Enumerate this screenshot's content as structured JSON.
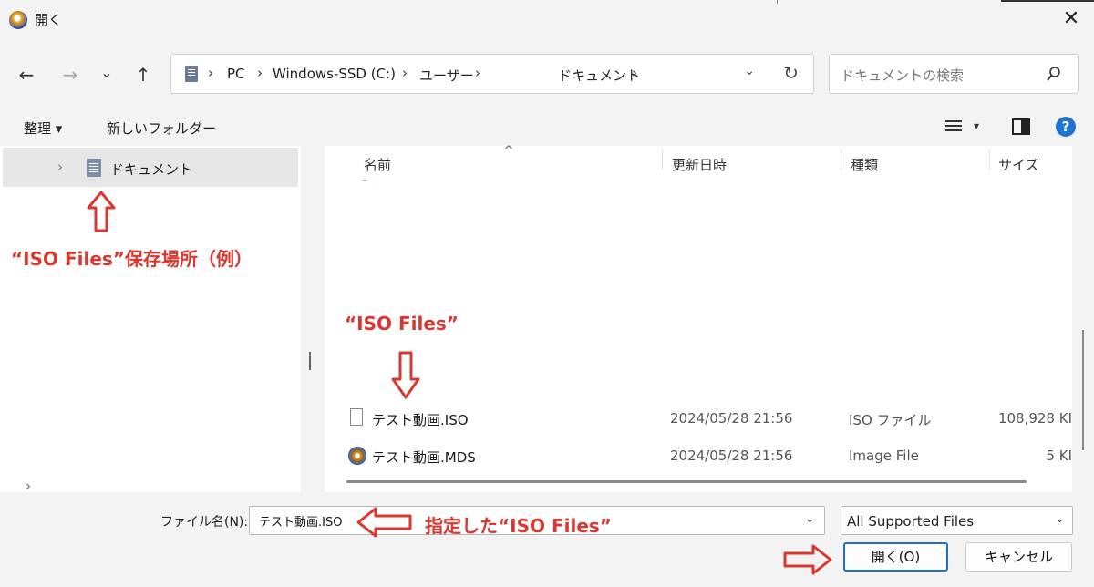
{
  "window": {
    "title": "開く",
    "close": "✕"
  },
  "nav": {
    "back": "←",
    "forward": "→",
    "recent": "⌄",
    "up": "↑"
  },
  "address": {
    "crumbs": [
      "PC",
      "Windows-SSD (C:)",
      "ユーザー",
      "ドキュメント"
    ],
    "separator": "›",
    "dropdown": "⌄",
    "refresh": "↻"
  },
  "search": {
    "placeholder": "ドキュメントの検索"
  },
  "toolbar": {
    "organize": "整理 ▾",
    "new_folder": "新しいフォルダー",
    "view_caret": "▾",
    "help": "?"
  },
  "navpane": {
    "selected_item": "ドキュメント",
    "expander": "›",
    "bottom_expander": "›"
  },
  "filelist": {
    "sort_indicator": "^",
    "columns": [
      "名前",
      "更新日時",
      "種類",
      "サイズ"
    ],
    "rows": [
      {
        "name": "テスト動画.ISO",
        "date": "2024/05/28 21:56",
        "type": "ISO ファイル",
        "size": "108,928 KI"
      },
      {
        "name": "テスト動画.MDS",
        "date": "2024/05/28 21:56",
        "type": "Image File",
        "size": "5 KI"
      }
    ]
  },
  "bottom": {
    "filename_label": "ファイル名(N):",
    "filename_value": "テスト動画.ISO",
    "filter_value": "All Supported Files",
    "chevron": "⌄",
    "open_button": "開く(O)",
    "cancel_button": "キャンセル"
  },
  "annotations": {
    "location": "“ISO Files”保存場所（例）",
    "files": "“ISO Files”",
    "specified": "指定した“ISO Files”"
  },
  "colors": {
    "annotation": "#d9372f",
    "accent": "#1e6fd0",
    "help": "#1f74d1"
  }
}
